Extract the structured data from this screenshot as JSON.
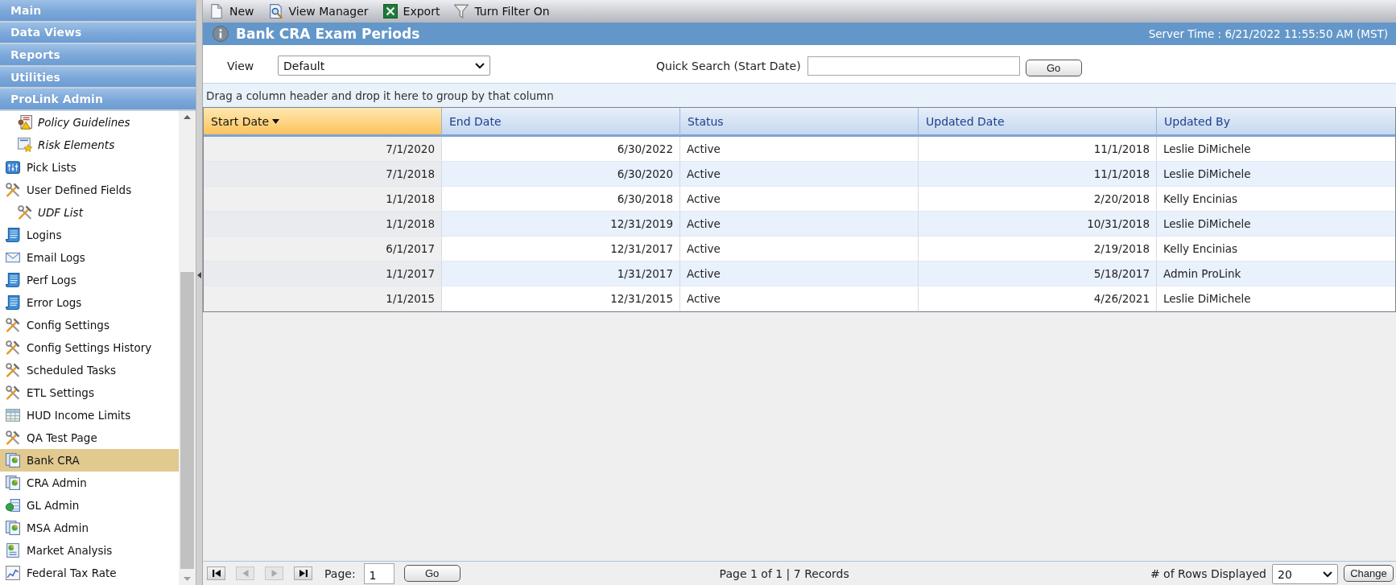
{
  "sidebar": {
    "sections": [
      {
        "label": "Main"
      },
      {
        "label": "Data Views"
      },
      {
        "label": "Reports"
      },
      {
        "label": "Utilities"
      },
      {
        "label": "ProLink Admin"
      }
    ],
    "items": [
      {
        "children": [
          {
            "label": "Policy Guidelines",
            "kind": "policy",
            "selected": false
          },
          {
            "label": "Risk Elements",
            "kind": "risk",
            "selected": false
          }
        ]
      },
      {
        "label": "Pick Lists",
        "kind": "pick-list",
        "selected": false
      },
      {
        "label": "User Defined Fields",
        "kind": "tools",
        "selected": false,
        "children": [
          {
            "label": "UDF List",
            "kind": "tools",
            "selected": false
          }
        ]
      },
      {
        "label": "Logins",
        "kind": "log",
        "selected": false
      },
      {
        "label": "Email Logs",
        "kind": "mail",
        "selected": false
      },
      {
        "label": "Perf Logs",
        "kind": "log",
        "selected": false
      },
      {
        "label": "Error Logs",
        "kind": "log",
        "selected": false
      },
      {
        "label": "Config Settings",
        "kind": "tools",
        "selected": false
      },
      {
        "label": "Config Settings History",
        "kind": "tools",
        "selected": false
      },
      {
        "label": "Scheduled Tasks",
        "kind": "tools",
        "selected": false
      },
      {
        "label": "ETL Settings",
        "kind": "tools",
        "selected": false
      },
      {
        "label": "HUD Income Limits",
        "kind": "table",
        "selected": false
      },
      {
        "label": "QA Test Page",
        "kind": "tools",
        "selected": false
      },
      {
        "label": "Bank CRA",
        "kind": "report",
        "selected": true
      },
      {
        "label": "CRA Admin",
        "kind": "report",
        "selected": false
      },
      {
        "label": "GL Admin",
        "kind": "ledger",
        "selected": false
      },
      {
        "label": "MSA Admin",
        "kind": "report",
        "selected": false
      },
      {
        "label": "Market Analysis",
        "kind": "pie-sheet",
        "selected": false
      },
      {
        "label": "Federal Tax Rate",
        "kind": "chart",
        "selected": false
      }
    ]
  },
  "toolbar": [
    {
      "label": "New",
      "kind": "new"
    },
    {
      "label": "View Manager",
      "kind": "view-manager"
    },
    {
      "label": "Export",
      "kind": "export"
    },
    {
      "label": "Turn Filter On",
      "kind": "filter"
    }
  ],
  "page": {
    "title": "Bank CRA Exam Periods",
    "server_time": "Server Time : 6/21/2022 11:55:50 AM (MST)"
  },
  "filters": {
    "view_label": "View",
    "view_value": "Default",
    "search_label": "Quick Search (Start Date)",
    "search_button": "Go"
  },
  "group_panel": "Drag a column header and drop it here to group by that column",
  "table": {
    "columns": [
      {
        "label": "Start Date",
        "kind": "date",
        "sorted": true
      },
      {
        "label": "End Date",
        "kind": "date",
        "sorted": false
      },
      {
        "label": "Status",
        "kind": "text",
        "sorted": false
      },
      {
        "label": "Updated Date",
        "kind": "date",
        "sorted": false
      },
      {
        "label": "Updated By",
        "kind": "text",
        "sorted": false
      }
    ],
    "rows": [
      [
        "7/1/2020",
        "6/30/2022",
        "Active",
        "11/1/2018",
        "Leslie DiMichele"
      ],
      [
        "7/1/2018",
        "6/30/2020",
        "Active",
        "11/1/2018",
        "Leslie DiMichele"
      ],
      [
        "1/1/2018",
        "6/30/2018",
        "Active",
        "2/20/2018",
        "Kelly Encinias"
      ],
      [
        "1/1/2018",
        "12/31/2019",
        "Active",
        "10/31/2018",
        "Leslie DiMichele"
      ],
      [
        "6/1/2017",
        "12/31/2017",
        "Active",
        "2/19/2018",
        "Kelly Encinias"
      ],
      [
        "1/1/2017",
        "1/31/2017",
        "Active",
        "5/18/2017",
        "Admin ProLink"
      ],
      [
        "1/1/2015",
        "12/31/2015",
        "Active",
        "4/26/2021",
        "Leslie DiMichele"
      ]
    ]
  },
  "pager": {
    "nav": [
      {
        "kind": "first",
        "disabled": false
      },
      {
        "kind": "prev",
        "disabled": true
      },
      {
        "kind": "next",
        "disabled": true
      },
      {
        "kind": "last",
        "disabled": false
      }
    ],
    "page_label": "Page:",
    "page_value": "1",
    "go": "Go",
    "status": "Page 1 of 1 | 7 Records",
    "rows_label": "# of Rows Displayed",
    "rows_value": "20",
    "change": "Change"
  }
}
